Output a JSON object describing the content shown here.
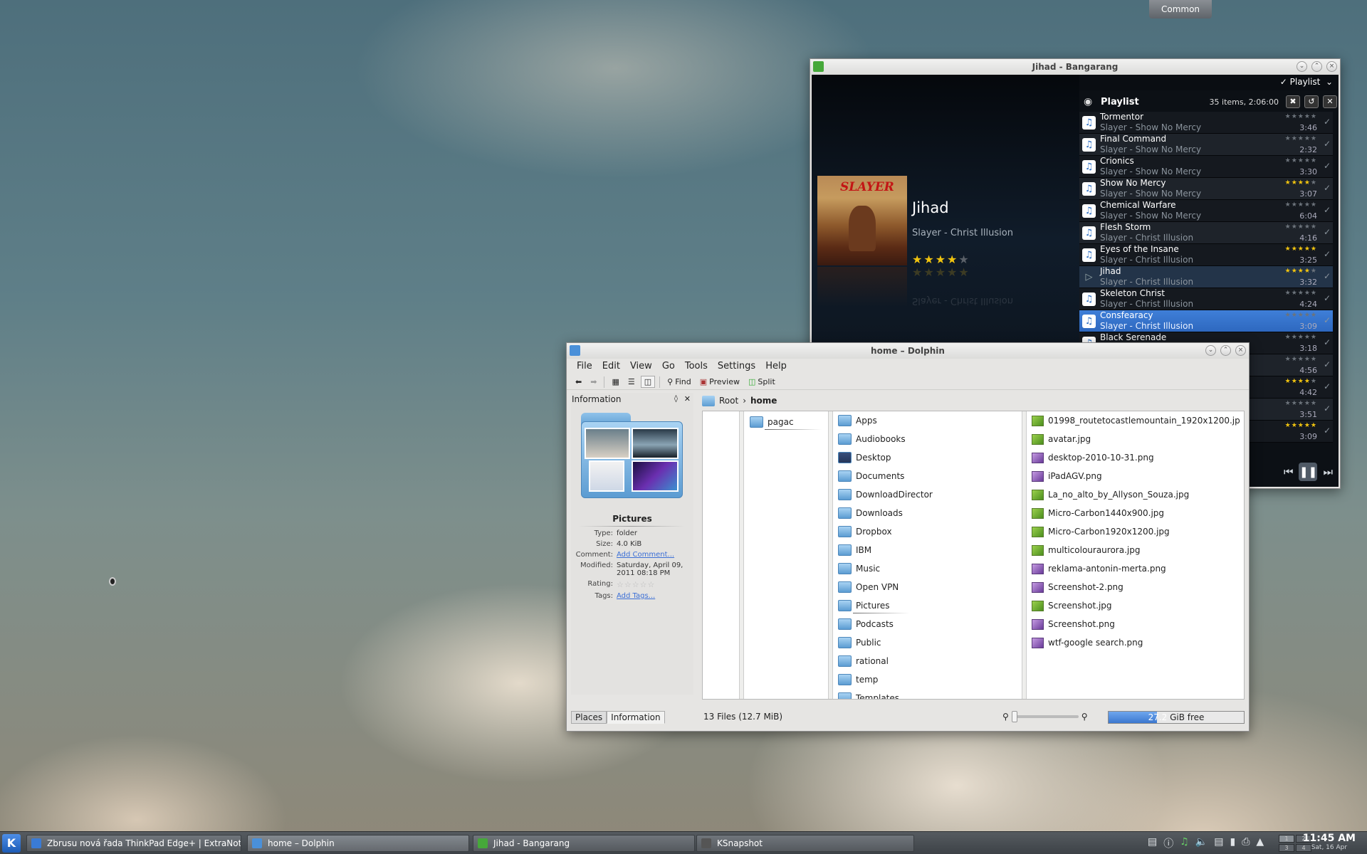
{
  "desktop": {
    "common_label": "Common"
  },
  "bangarang": {
    "title": "Jihad - Bangarang",
    "mode_toggle": "Playlist",
    "now_playing": {
      "title": "Jihad",
      "artist_album": "Slayer - Christ Illusion",
      "rating": 4
    },
    "cover_art_text": "SLAYER",
    "playlist": {
      "label": "Playlist",
      "count": "35 items, 2:06:00",
      "items": [
        {
          "title": "Tormentor",
          "sub": "Slayer - Show No Mercy",
          "duration": "3:46",
          "rating": 0,
          "state": ""
        },
        {
          "title": "Final Command",
          "sub": "Slayer - Show No Mercy",
          "duration": "2:32",
          "rating": 0,
          "state": ""
        },
        {
          "title": "Crionics",
          "sub": "Slayer - Show No Mercy",
          "duration": "3:30",
          "rating": 0,
          "state": ""
        },
        {
          "title": "Show No Mercy",
          "sub": "Slayer - Show No Mercy",
          "duration": "3:07",
          "rating": 4,
          "state": ""
        },
        {
          "title": "Chemical Warfare",
          "sub": "Slayer - Show No Mercy",
          "duration": "6:04",
          "rating": 0,
          "state": ""
        },
        {
          "title": "Flesh Storm",
          "sub": "Slayer - Christ Illusion",
          "duration": "4:16",
          "rating": 0,
          "state": ""
        },
        {
          "title": "Eyes of the Insane",
          "sub": "Slayer - Christ Illusion",
          "duration": "3:25",
          "rating": 5,
          "state": ""
        },
        {
          "title": "Jihad",
          "sub": "Slayer - Christ Illusion",
          "duration": "3:32",
          "rating": 4,
          "state": "playing"
        },
        {
          "title": "Skeleton Christ",
          "sub": "Slayer - Christ Illusion",
          "duration": "4:24",
          "rating": 0,
          "state": ""
        },
        {
          "title": "Consfearacy",
          "sub": "Slayer - Christ Illusion",
          "duration": "3:09",
          "rating": 0,
          "state": "selected"
        },
        {
          "title": "Black Serenade",
          "sub": "",
          "duration": "3:18",
          "rating": 0,
          "state": ""
        },
        {
          "title": "",
          "sub": "",
          "duration": "4:56",
          "rating": 0,
          "state": ""
        },
        {
          "title": "",
          "sub": "",
          "duration": "4:42",
          "rating": 4,
          "state": ""
        },
        {
          "title": "",
          "sub": "",
          "duration": "3:51",
          "rating": 0,
          "state": ""
        },
        {
          "title": "",
          "sub": "",
          "duration": "3:09",
          "rating": 5,
          "state": ""
        }
      ]
    }
  },
  "dolphin": {
    "title": "home – Dolphin",
    "menu": [
      "File",
      "Edit",
      "View",
      "Go",
      "Tools",
      "Settings",
      "Help"
    ],
    "toolbar": {
      "find": "Find",
      "preview": "Preview",
      "split": "Split"
    },
    "info_panel": {
      "header": "Information",
      "name": "Pictures",
      "type_label": "Type:",
      "type": "folder",
      "size_label": "Size:",
      "size": "4.0 KiB",
      "comment_label": "Comment:",
      "comment": "Add Comment...",
      "modified_label": "Modified:",
      "modified": "Saturday, April 09, 2011 08:18 PM",
      "rating_label": "Rating:",
      "rating": "☆☆☆☆☆",
      "tags_label": "Tags:",
      "tags": "Add Tags..."
    },
    "panel_tabs": [
      "Places",
      "Information"
    ],
    "breadcrumb": [
      "Root",
      "home"
    ],
    "col1": [
      "pagac"
    ],
    "col2": [
      "Apps",
      "Audiobooks",
      "Desktop",
      "Documents",
      "DownloadDirector",
      "Downloads",
      "Dropbox",
      "IBM",
      "Music",
      "Open VPN",
      "Pictures",
      "Podcasts",
      "Public",
      "rational",
      "temp",
      "Templates"
    ],
    "col3": [
      {
        "name": "01998_routetocastlemountain_1920x1200.jpg",
        "kind": "g"
      },
      {
        "name": "avatar.jpg",
        "kind": "g"
      },
      {
        "name": "desktop-2010-10-31.png",
        "kind": "p"
      },
      {
        "name": "iPadAGV.png",
        "kind": "p"
      },
      {
        "name": "La_no_alto_by_Allyson_Souza.jpg",
        "kind": "g"
      },
      {
        "name": "Micro-Carbon1440x900.jpg",
        "kind": "g"
      },
      {
        "name": "Micro-Carbon1920x1200.jpg",
        "kind": "g"
      },
      {
        "name": "multicolouraurora.jpg",
        "kind": "g"
      },
      {
        "name": "reklama-antonin-merta.png",
        "kind": "p"
      },
      {
        "name": "Screenshot-2.png",
        "kind": "p"
      },
      {
        "name": "Screenshot.jpg",
        "kind": "g"
      },
      {
        "name": "Screenshot.png",
        "kind": "p"
      },
      {
        "name": "wtf-google search.png",
        "kind": "p"
      }
    ],
    "status": {
      "count": "13 Files (12.7 MiB)",
      "free_value": "27.2",
      "free_unit": " GiB free",
      "used_fraction": 0.36
    }
  },
  "taskbar": {
    "tasks": [
      {
        "label": "Zbrusu nová řada ThinkPad Edge+ | ExtraNotebo",
        "color": "#3a7bd5"
      },
      {
        "label": "home – Dolphin",
        "color": "#4a90d9"
      },
      {
        "label": "Jihad - Bangarang",
        "color": "#46a83a"
      },
      {
        "label": "KSnapshot",
        "color": "#555555"
      }
    ],
    "pager": [
      "1",
      "2",
      "3",
      "4"
    ],
    "time": "11:45 AM",
    "date": "Sat, 16 Apr"
  }
}
